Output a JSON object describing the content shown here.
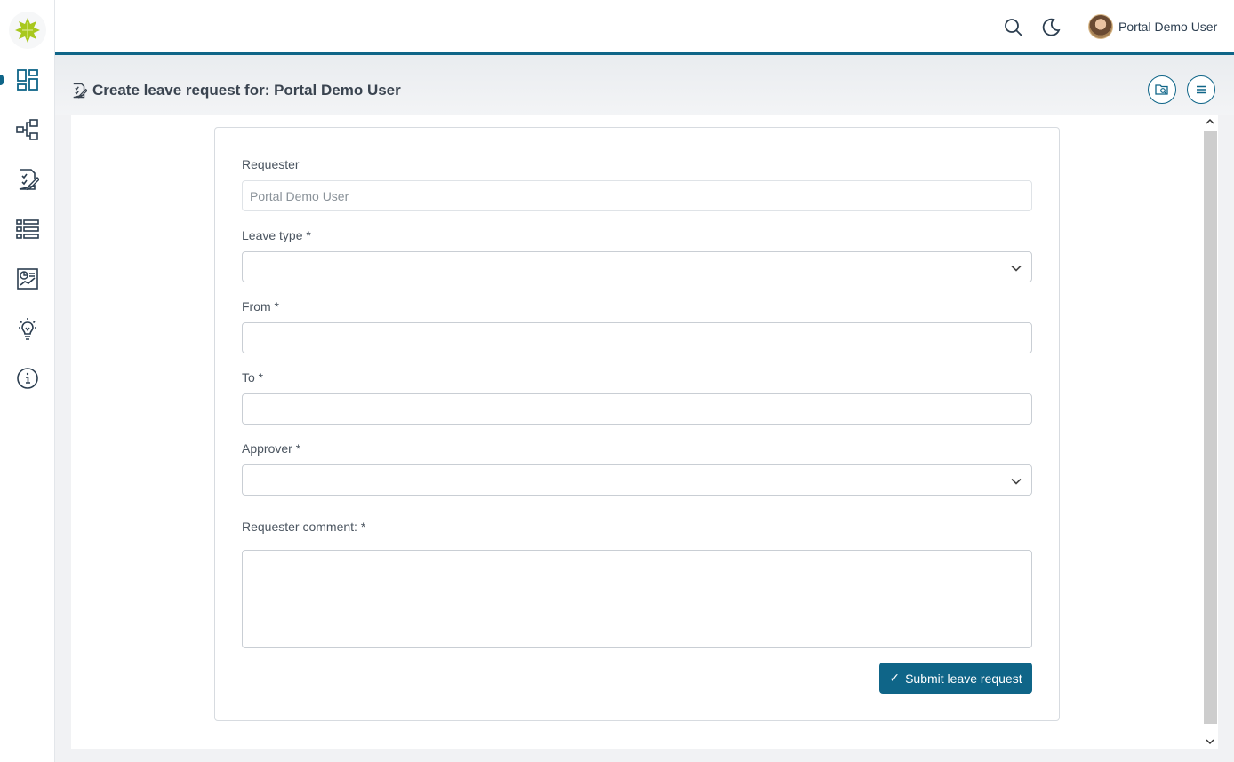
{
  "topbar": {
    "user_name": "Portal Demo User",
    "search_icon": "search-icon",
    "theme_icon": "moon-icon"
  },
  "sidebar": {
    "items": [
      {
        "icon": "dashboard-icon",
        "active": true
      },
      {
        "icon": "process-icon",
        "active": false
      },
      {
        "icon": "tasks-icon",
        "active": false
      },
      {
        "icon": "list-icon",
        "active": false
      },
      {
        "icon": "statistics-icon",
        "active": false
      },
      {
        "icon": "lightbulb-icon",
        "active": false
      },
      {
        "icon": "info-icon",
        "active": false
      }
    ]
  },
  "page": {
    "title": "Create leave request for: Portal Demo User"
  },
  "form": {
    "requester_label": "Requester",
    "requester_value": "Portal Demo User",
    "leave_type_label": "Leave type *",
    "leave_type_value": "",
    "from_label": "From *",
    "from_value": "",
    "to_label": "To  *",
    "to_value": "",
    "approver_label": "Approver *",
    "approver_value": "",
    "comment_label": "Requester comment:  *",
    "comment_value": "",
    "submit_label": "Submit leave request",
    "submit_icon": "✓"
  },
  "colors": {
    "accent": "#0f6588",
    "logo": "#a8c81e"
  }
}
